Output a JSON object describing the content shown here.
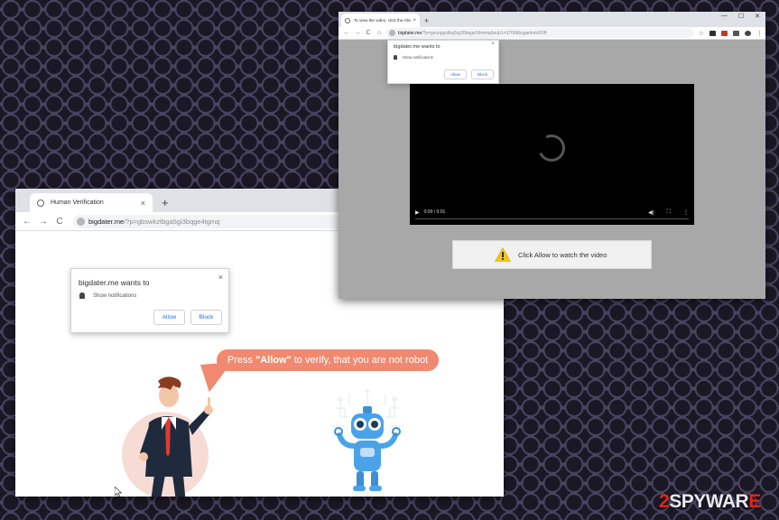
{
  "left_browser": {
    "tab_title": "Human Verification",
    "tab_close": "×",
    "new_tab": "+",
    "nav": {
      "back": "←",
      "forward": "→",
      "reload": "C"
    },
    "url_host": "bigdater.me",
    "url_path": "/?p=gbswkztbga5gi3bqge4tgmq",
    "permission": {
      "title": "bigdater.me wants to",
      "close": "×",
      "item": "Show notifications",
      "allow": "Allow",
      "block": "Block"
    },
    "bubble": {
      "prefix": "Press",
      "highlight": "\"Allow\"",
      "suffix": "to verify, that you are not robot"
    }
  },
  "right_browser": {
    "tab_title": "To view the video, click the Allo",
    "tab_close": "×",
    "new_tab": "+",
    "window_controls": {
      "minimize": "—",
      "maximize": "☐",
      "close": "✕"
    },
    "nav": {
      "back": "←",
      "forward": "→",
      "reload": "C",
      "home": "⌂"
    },
    "url_host": "bigdater.me",
    "url_path": "/?p=gmzqgzdbg5rg20bqge2dmmq&sub1=3708dbzgariimk9Off",
    "star": "☆",
    "menu": "⋮",
    "permission": {
      "title": "bigdater.me wants to",
      "close": "×",
      "item": "Show notifications",
      "allow": "Allow",
      "block": "Block"
    },
    "video": {
      "time": "0:00 / 0:01",
      "play": "▶",
      "volume": "◀)",
      "fullscreen": "⛶",
      "more": "⋮"
    },
    "cta_text": "Click Allow to watch the video"
  },
  "watermark": {
    "digit": "2",
    "text": "SPYWAR",
    "suffix": "E"
  },
  "colors": {
    "bubble": "#f0896f",
    "allow_blue": "#1a73e8",
    "warning": "#f5c518",
    "watermark_red": "#e0261d"
  }
}
